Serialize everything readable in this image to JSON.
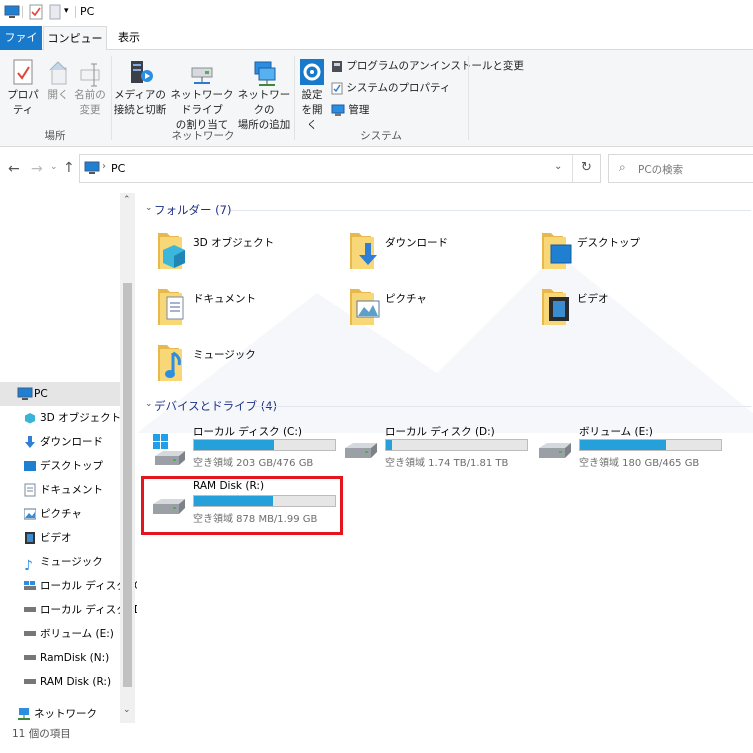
{
  "window": {
    "title": "PC"
  },
  "ribbon_tabs": [
    {
      "label": "ファイル",
      "active_file": true
    },
    {
      "label": "コンピューター",
      "selected": true
    },
    {
      "label": "表示"
    }
  ],
  "ribbon": {
    "location": {
      "properties": "プロパティ",
      "open": "開く",
      "rename_1": "名前の",
      "rename_2": "変更",
      "group": "場所"
    },
    "network": {
      "media_1": "メディアの",
      "media_2": "接続と切断",
      "map_1": "ネットワーク ドライブ",
      "map_2": "の割り当て",
      "add_1": "ネットワークの",
      "add_2": "場所の追加",
      "group": "ネットワーク"
    },
    "system": {
      "settings_1": "設定",
      "settings_2": "を開く",
      "uninstall": "プログラムのアンインストールと変更",
      "sysprops": "システムのプロパティ",
      "manage": "管理",
      "group": "システム"
    }
  },
  "address": {
    "path": "PC",
    "search_placeholder": "PCの検索"
  },
  "sidebar": [
    {
      "label": "PC",
      "icon": "pc-icon",
      "selected": true
    },
    {
      "label": "3D オブジェクト",
      "icon": "3d-objects-icon"
    },
    {
      "label": "ダウンロード",
      "icon": "download-icon"
    },
    {
      "label": "デスクトップ",
      "icon": "desktop-icon"
    },
    {
      "label": "ドキュメント",
      "icon": "document-icon"
    },
    {
      "label": "ピクチャ",
      "icon": "pictures-icon"
    },
    {
      "label": "ビデオ",
      "icon": "video-icon"
    },
    {
      "label": "ミュージック",
      "icon": "music-icon"
    },
    {
      "label": "ローカル ディスク (C:)",
      "icon": "drive-icon"
    },
    {
      "label": "ローカル ディスク (D:)",
      "icon": "drive-icon"
    },
    {
      "label": "ボリューム (E:)",
      "icon": "drive-icon"
    },
    {
      "label": "RamDisk (N:)",
      "icon": "drive-icon"
    },
    {
      "label": "RAM Disk (R:)",
      "icon": "drive-icon"
    }
  ],
  "sidebar_network": "ネットワーク",
  "folders_header": "フォルダー (7)",
  "folders": [
    {
      "label": "3D オブジェクト",
      "icon": "3d-objects-icon"
    },
    {
      "label": "ダウンロード",
      "icon": "download-icon"
    },
    {
      "label": "デスクトップ",
      "icon": "desktop-icon"
    },
    {
      "label": "ドキュメント",
      "icon": "document-icon"
    },
    {
      "label": "ピクチャ",
      "icon": "pictures-icon"
    },
    {
      "label": "ビデオ",
      "icon": "video-icon"
    },
    {
      "label": "ミュージック",
      "icon": "music-icon"
    }
  ],
  "drives_header": "デバイスとドライブ (4)",
  "drives": [
    {
      "name": "ローカル ディスク (C:)",
      "free": "空き領域 203 GB/476 GB",
      "used_fraction": 0.57,
      "icon": "windows-drive-icon"
    },
    {
      "name": "ローカル ディスク (D:)",
      "free": "空き領域 1.74 TB/1.81 TB",
      "used_fraction": 0.04,
      "icon": "drive-icon"
    },
    {
      "name": "ボリューム (E:)",
      "free": "空き領域 180 GB/465 GB",
      "used_fraction": 0.61,
      "icon": "drive-icon"
    },
    {
      "name": "RAM Disk (R:)",
      "free": "空き領域 878 MB/1.99 GB",
      "used_fraction": 0.56,
      "icon": "drive-icon"
    }
  ],
  "status": {
    "count": "11 個の項目"
  },
  "colors": {
    "accent": "#1979ca",
    "bar_fill": "#26a0da",
    "highlight": "#e3161d",
    "header_text": "#1e3287"
  }
}
